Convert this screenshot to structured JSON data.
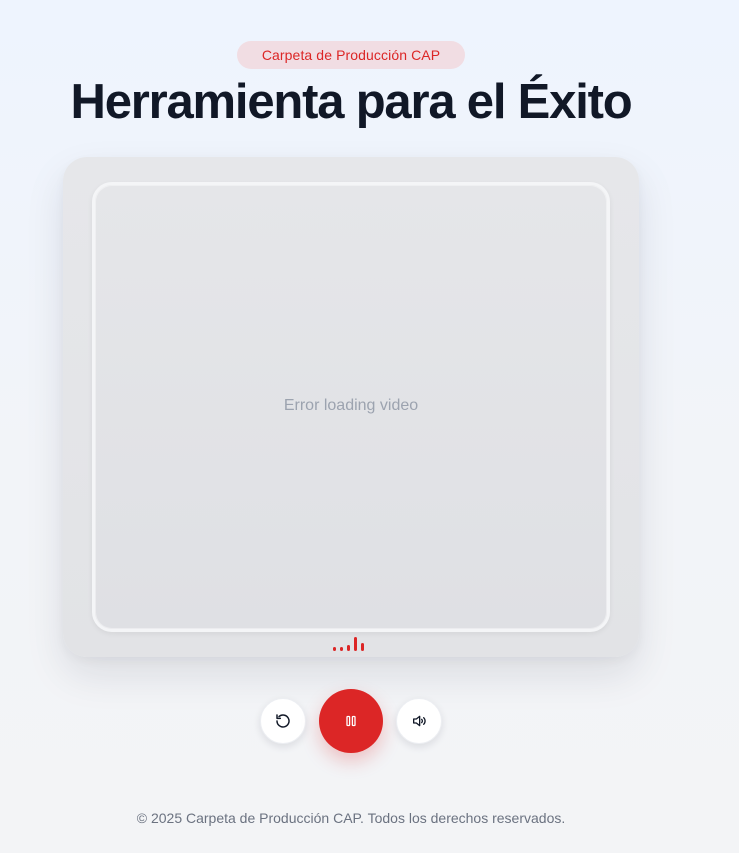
{
  "header": {
    "badge": "Carpeta de Producción CAP",
    "title": "Herramienta para el Éxito"
  },
  "player": {
    "status_text": "Error loading video",
    "state": "playing"
  },
  "controls": {
    "restart_icon": "restart-icon",
    "pause_icon": "pause-icon",
    "volume_icon": "volume-icon"
  },
  "footer": {
    "copyright": "© 2025 Carpeta de Producción CAP. Todos los derechos reservados."
  },
  "colors": {
    "accent": "#dc2626",
    "title": "#111827",
    "muted": "#9ca3af",
    "badge_bg": "#f1dde3"
  }
}
